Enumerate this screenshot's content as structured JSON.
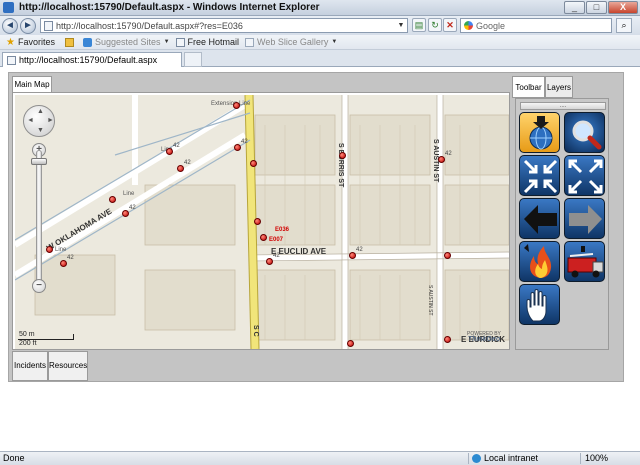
{
  "window": {
    "title": "http://localhost:15790/Default.aspx - Windows Internet Explorer",
    "minimize_glyph": "_",
    "maximize_glyph": "□",
    "close_glyph": "X"
  },
  "navigation": {
    "back_glyph": "◄",
    "forward_glyph": "►",
    "address_value": "http://localhost:15790/Default.aspx#?res=E036",
    "address_dropdown_glyph": "▼",
    "search_placeholder": "Google",
    "search_glyph": "⌕",
    "icons": [
      "back-icon",
      "forward-icon",
      "page-icon",
      "compatibility-icon",
      "refresh-icon",
      "stop-icon",
      "google-icon",
      "search-icon"
    ],
    "refresh_glyph": "↻",
    "stop_glyph": "✕",
    "compat_glyph": "▤"
  },
  "favorites_bar": {
    "favorites_label": "Favorites",
    "items": [
      {
        "label": "Suggested Sites"
      },
      {
        "label": "Free Hotmail"
      },
      {
        "label": "Web Slice Gallery"
      }
    ],
    "dropdown_glyph": "▼"
  },
  "browser_tab": {
    "label": "http://localhost:15790/Default.aspx"
  },
  "map_panel": {
    "tab_label": "Main Map",
    "streets": {
      "s_burris": "S BURRIS ST",
      "s_austin": "S AUSTIN ST",
      "e_euclid": "E EUCLID AVE",
      "e_euclid_2": "E EUCLID AVE",
      "w_oklahoma": "W OKLAHOMA AVE",
      "s_c": "S C",
      "e_eurdick": "E EURDICK",
      "extension_line": "Extension Line",
      "line_1": "Line",
      "line_2": "Line",
      "line_3": "Line",
      "s_austin_small": "S AUSTIN ST"
    },
    "unit_labels": {
      "e036": "E036",
      "e007": "E007"
    },
    "point_labels": [
      "42",
      "42",
      "42",
      "42",
      "42",
      "42",
      "42",
      "42"
    ],
    "scale": {
      "meters": "50 m",
      "feet": "200 ft"
    },
    "powered_by": "POWERED BY",
    "powered_brand": "ThinkGeo",
    "pan_arrows": {
      "up": "▲",
      "down": "▼",
      "left": "◄",
      "right": "►"
    },
    "zoom_in": "+",
    "zoom_out": "−"
  },
  "side_panel": {
    "tabs": [
      "Toolbar",
      "Layers"
    ],
    "grip_glyph": "....",
    "tools": [
      {
        "name": "navigate-tool",
        "icon": "pointer-globe-icon"
      },
      {
        "name": "search-tool",
        "icon": "magnifier-icon"
      },
      {
        "name": "zoom-in-extent-tool",
        "icon": "arrows-inward-icon"
      },
      {
        "name": "zoom-out-extent-tool",
        "icon": "arrows-outward-icon"
      },
      {
        "name": "previous-extent-tool",
        "icon": "arrow-left-icon"
      },
      {
        "name": "next-extent-tool",
        "icon": "arrow-right-icon"
      },
      {
        "name": "add-incident-tool",
        "icon": "fire-icon"
      },
      {
        "name": "add-resource-tool",
        "icon": "fire-truck-icon"
      },
      {
        "name": "pan-tool",
        "icon": "hand-icon"
      }
    ]
  },
  "bottom_tabs": [
    "Incidents",
    "Resources"
  ],
  "status_bar": {
    "status": "Done",
    "zone": "Local intranet",
    "zoom": "100%"
  }
}
